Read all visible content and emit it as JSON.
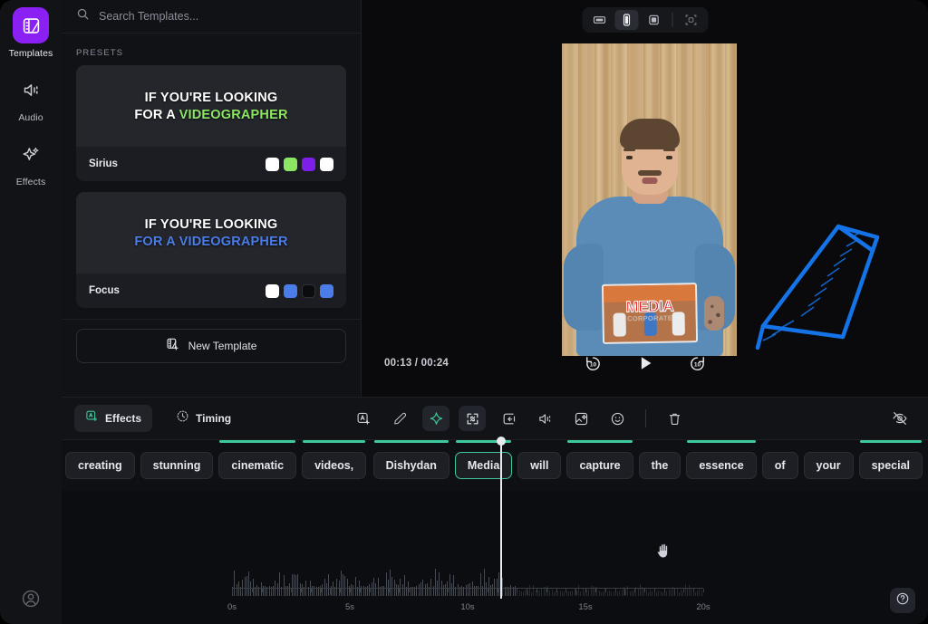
{
  "rail": {
    "items": [
      {
        "label": "Templates",
        "icon": "templates-icon",
        "active": true
      },
      {
        "label": "Audio",
        "icon": "audio-icon",
        "active": false
      },
      {
        "label": "Effects",
        "icon": "effects-sparkle-icon",
        "active": false
      }
    ],
    "account_icon": "user-account-icon"
  },
  "panel": {
    "search": {
      "placeholder": "Search Templates...",
      "value": "",
      "icon": "search-icon"
    },
    "presets_label": "PRESETS",
    "presets": [
      {
        "name": "Sirius",
        "thumb_line1": "IF YOU'RE LOOKING",
        "thumb_line2_plain": "FOR A ",
        "thumb_line2_highlight": "VIDEOGRAPHER",
        "highlight_color": "#8CE563",
        "swatches": [
          "#FFFFFF",
          "#8CE563",
          "#7C1FE8",
          "#FFFFFF"
        ]
      },
      {
        "name": "Focus",
        "thumb_line1": "IF YOU'RE LOOKING",
        "thumb_line2_plain": "",
        "thumb_line2_highlight": "FOR A VIDEOGRAPHER",
        "highlight_color": "#4A7DE8",
        "swatches": [
          "#FFFFFF",
          "#4A7DE8",
          "#0B0C0E",
          "#4A7DE8"
        ]
      }
    ],
    "new_template": {
      "label": "New Template",
      "icon": "new-template-icon"
    }
  },
  "preview": {
    "ratios": [
      {
        "name": "landscape",
        "icon": "ratio-landscape-icon",
        "active": false
      },
      {
        "name": "portrait",
        "icon": "ratio-portrait-icon",
        "active": true
      },
      {
        "name": "square",
        "icon": "ratio-square-icon",
        "active": false
      },
      {
        "name": "auto-fit",
        "icon": "ratio-autofit-icon",
        "active": false
      }
    ],
    "time_current": "00:13",
    "time_total": "00:24",
    "time_display": "00:13 / 00:24",
    "transport": [
      {
        "name": "rewind-10-button",
        "icon": "rewind-10-icon",
        "label": "10"
      },
      {
        "name": "play-button",
        "icon": "play-icon",
        "label": ""
      },
      {
        "name": "forward-10-button",
        "icon": "forward-10-icon",
        "label": "10"
      }
    ],
    "video": {
      "magazine_title": "MEDIA",
      "magazine_subtitle": "CORPORATE"
    },
    "annotation": {
      "type": "hand-drawn-arrow",
      "color": "#1573E8"
    }
  },
  "toolbar": {
    "tabs": [
      {
        "label": "Effects",
        "icon": "text-effects-icon",
        "active": true
      },
      {
        "label": "Timing",
        "icon": "clock-icon",
        "active": false
      }
    ],
    "tools": [
      {
        "name": "add-text-tool",
        "icon": "add-text-icon",
        "active": false
      },
      {
        "name": "edit-tool",
        "icon": "pencil-icon",
        "active": false
      },
      {
        "name": "magic-tool",
        "icon": "sparkle-icon",
        "active": true
      },
      {
        "name": "expand-tool",
        "icon": "expand-icon",
        "active": true
      },
      {
        "name": "split-tool",
        "icon": "split-clip-icon",
        "active": false
      },
      {
        "name": "volume-tool",
        "icon": "volume-icon",
        "active": false
      },
      {
        "name": "image-tool",
        "icon": "image-sparkle-icon",
        "active": false
      },
      {
        "name": "emoji-tool",
        "icon": "smiley-icon",
        "active": false
      },
      {
        "name": "delete-tool",
        "icon": "trash-icon",
        "active": false
      }
    ],
    "hide_captions": {
      "name": "hide-captions-button",
      "icon": "eye-off-icon"
    },
    "accent_color": "#3EC99A"
  },
  "captions": {
    "words": [
      {
        "text": "creating",
        "marker": false,
        "selected": false,
        "gap_after": false
      },
      {
        "text": "stunning",
        "marker": false,
        "selected": false,
        "gap_after": false
      },
      {
        "text": "cinematic",
        "marker": true,
        "selected": false,
        "gap_after": false
      },
      {
        "text": "videos,",
        "marker": true,
        "selected": false,
        "gap_after": true
      },
      {
        "text": "Dishydan",
        "marker": true,
        "selected": false,
        "gap_after": false
      },
      {
        "text": "Media",
        "marker": true,
        "selected": true,
        "gap_after": false
      },
      {
        "text": "will",
        "marker": false,
        "selected": false,
        "gap_after": false
      },
      {
        "text": "capture",
        "marker": true,
        "selected": false,
        "gap_after": false
      },
      {
        "text": "the",
        "marker": false,
        "selected": false,
        "gap_after": false
      },
      {
        "text": "essence",
        "marker": true,
        "selected": false,
        "gap_after": false
      },
      {
        "text": "of",
        "marker": false,
        "selected": false,
        "gap_after": false
      },
      {
        "text": "your",
        "marker": false,
        "selected": false,
        "gap_after": false
      },
      {
        "text": "special",
        "marker": true,
        "selected": false,
        "gap_after": false
      }
    ]
  },
  "timeline": {
    "ruler_labels": [
      "0s",
      "5s",
      "10s",
      "15s",
      "20s"
    ],
    "ruler_positions": [
      0,
      25,
      50,
      75,
      100
    ],
    "playhead_seconds": 13.8,
    "cursor": "grab-hand-cursor",
    "help": {
      "name": "help-button",
      "icon": "question-mark-icon"
    }
  }
}
